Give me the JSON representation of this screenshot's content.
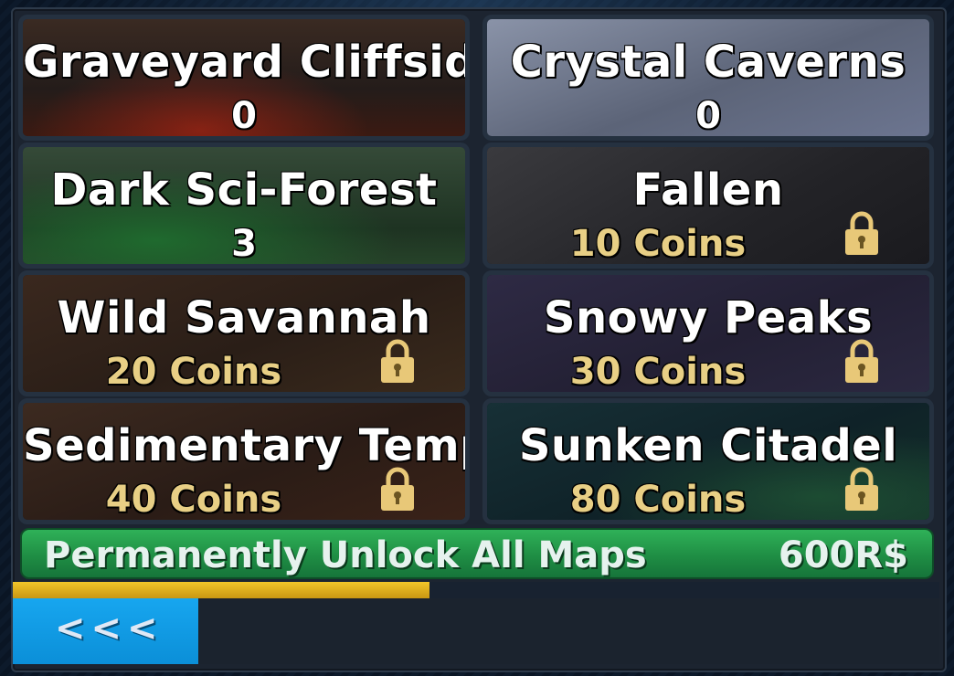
{
  "maps": [
    {
      "name": "Graveyard Cliffside",
      "status_text": "0",
      "locked": false,
      "theme": "graveyard"
    },
    {
      "name": "Crystal Caverns",
      "status_text": "0",
      "locked": false,
      "theme": "crystal"
    },
    {
      "name": "Dark Sci-Forest",
      "status_text": "3",
      "locked": false,
      "theme": "forest"
    },
    {
      "name": "Fallen",
      "status_text": "10 Coins",
      "locked": true,
      "theme": "fallen"
    },
    {
      "name": "Wild Savannah",
      "status_text": "20 Coins",
      "locked": true,
      "theme": "savannah"
    },
    {
      "name": "Snowy Peaks",
      "status_text": "30 Coins",
      "locked": true,
      "theme": "snowy"
    },
    {
      "name": "Sedimentary Temple",
      "status_text": "40 Coins",
      "locked": true,
      "theme": "temple"
    },
    {
      "name": "Sunken Citadel",
      "status_text": "80 Coins",
      "locked": true,
      "theme": "citadel"
    }
  ],
  "unlock_all": {
    "label": "Permanently Unlock All Maps",
    "price": "600R$"
  },
  "progress": {
    "fraction": 0.45
  },
  "back_button": {
    "label": "<<<"
  },
  "colors": {
    "price_text": "#e8cf85",
    "unlock_green": "#1f8e44",
    "progress_gold": "#f2c52a",
    "back_blue": "#17a6ef",
    "lock_gold": "#e8c878"
  }
}
